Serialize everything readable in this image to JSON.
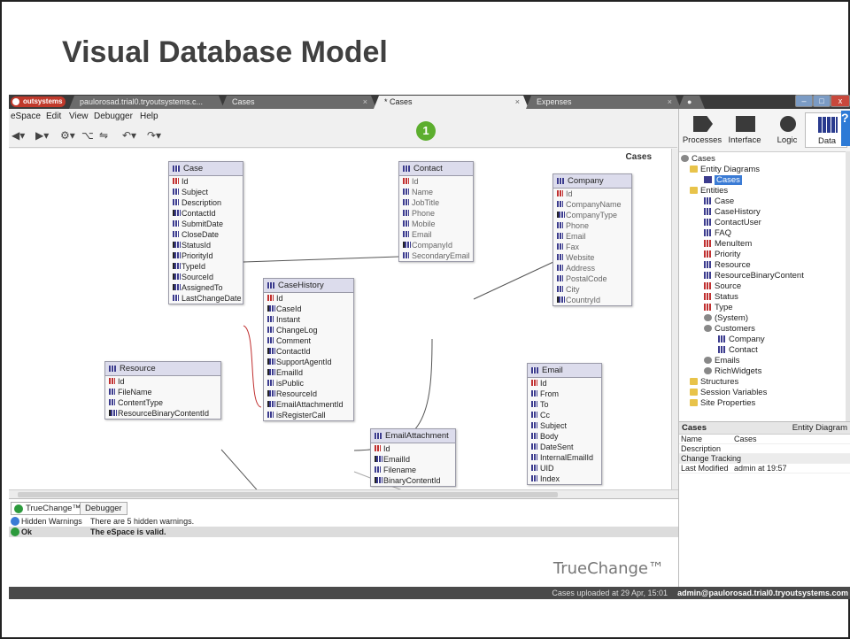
{
  "slide_title": "Visual Database Model",
  "tabs": {
    "brand": "outsystems",
    "items": [
      {
        "label": "paulorosad.trial0.tryoutsystems.c...",
        "active": false
      },
      {
        "label": "Cases",
        "active": false
      },
      {
        "label": "* Cases",
        "active": true
      },
      {
        "label": "Expenses",
        "active": false
      }
    ],
    "close": "×"
  },
  "menu": [
    "eSpace",
    "Edit",
    "View",
    "Debugger",
    "Help"
  ],
  "step_badge": "1",
  "canvas": {
    "label": "Cases",
    "entities": {
      "case": {
        "title": "Case",
        "attrs": [
          "Id",
          "Subject",
          "Description",
          "ContactId",
          "SubmitDate",
          "CloseDate",
          "StatusId",
          "PriorityId",
          "TypeId",
          "SourceId",
          "AssignedTo",
          "LastChangeDate"
        ]
      },
      "contact": {
        "title": "Contact",
        "attrs": [
          "Id",
          "Name",
          "JobTitle",
          "Phone",
          "Mobile",
          "Email",
          "CompanyId",
          "SecondaryEmail"
        ]
      },
      "company": {
        "title": "Company",
        "attrs": [
          "Id",
          "CompanyName",
          "CompanyType",
          "Phone",
          "Email",
          "Fax",
          "Website",
          "Address",
          "PostalCode",
          "City",
          "CountryId"
        ]
      },
      "casehistory": {
        "title": "CaseHistory",
        "attrs": [
          "Id",
          "CaseId",
          "Instant",
          "ChangeLog",
          "Comment",
          "ContactId",
          "SupportAgentId",
          "EmailId",
          "isPublic",
          "ResourceId",
          "EmailAttachmentId",
          "isRegisterCall"
        ]
      },
      "resource": {
        "title": "Resource",
        "attrs": [
          "Id",
          "FileName",
          "ContentType",
          "ResourceBinaryContentId"
        ]
      },
      "email": {
        "title": "Email",
        "attrs": [
          "Id",
          "From",
          "To",
          "Cc",
          "Subject",
          "Body",
          "DateSent",
          "InternalEmailId",
          "UID",
          "Index"
        ]
      },
      "emailattachment": {
        "title": "EmailAttachment",
        "attrs": [
          "Id",
          "EmailId",
          "Filename",
          "BinaryContentId"
        ]
      }
    }
  },
  "bottom": {
    "tabs": [
      "TrueChange™",
      "Debugger"
    ],
    "messages": [
      {
        "type": "Hidden Warnings",
        "text": "There are 5 hidden warnings."
      },
      {
        "type": "Ok",
        "text": "The eSpace is valid."
      }
    ],
    "logo": "TrueChange™"
  },
  "layers": [
    "Processes",
    "Interface",
    "Logic",
    "Data"
  ],
  "tree": {
    "root": "Cases",
    "entity_diagrams": "Entity Diagrams",
    "diagram": "Cases",
    "entities_folder": "Entities",
    "entities": [
      "Case",
      "CaseHistory",
      "ContactUser",
      "FAQ",
      "MenuItem",
      "Priority",
      "Resource",
      "ResourceBinaryContent",
      "Source",
      "Status",
      "Type"
    ],
    "system": "(System)",
    "customers": "Customers",
    "customer_entities": [
      "Company",
      "Contact"
    ],
    "emails": "Emails",
    "richwidgets": "RichWidgets",
    "structures": "Structures",
    "session_variables": "Session Variables",
    "site_properties": "Site Properties"
  },
  "properties": {
    "title": "Cases",
    "kind": "Entity Diagram",
    "rows": [
      {
        "label": "Name",
        "value": "Cases"
      },
      {
        "label": "Description",
        "value": ""
      }
    ],
    "section": "Change Tracking",
    "last_modified_label": "Last Modified",
    "last_modified_value": "admin at 19:57"
  },
  "status": {
    "left": "Cases uploaded at 29 Apr, 15:01",
    "right": "admin@paulorosad.trial0.tryoutsystems.com"
  }
}
